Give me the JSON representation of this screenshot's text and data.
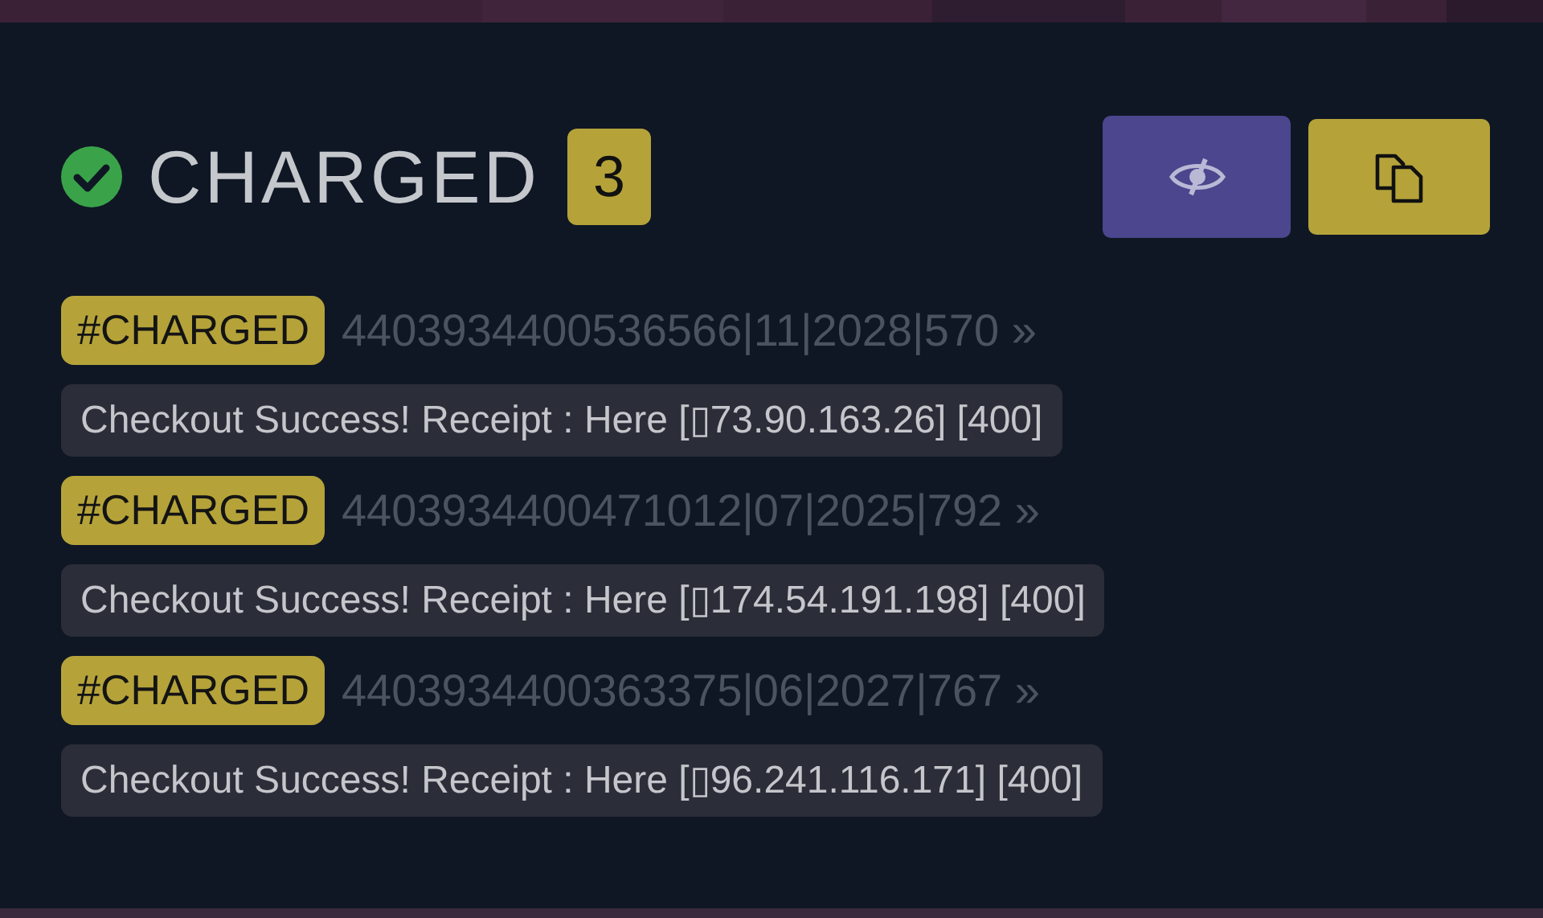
{
  "header": {
    "title": "CHARGED",
    "count": "3"
  },
  "entries": [
    {
      "tag": "#CHARGED",
      "card": "4403934400536566|11|2028|570 »",
      "message": "Checkout Success! Receipt : Here [▯73.90.163.26] [400]"
    },
    {
      "tag": "#CHARGED",
      "card": "4403934400471012|07|2025|792 »",
      "message": "Checkout Success! Receipt : Here [▯174.54.191.198] [400]"
    },
    {
      "tag": "#CHARGED",
      "card": "4403934400363375|06|2027|767 »",
      "message": "Checkout Success! Receipt : Here [▯96.241.116.171] [400]"
    }
  ]
}
